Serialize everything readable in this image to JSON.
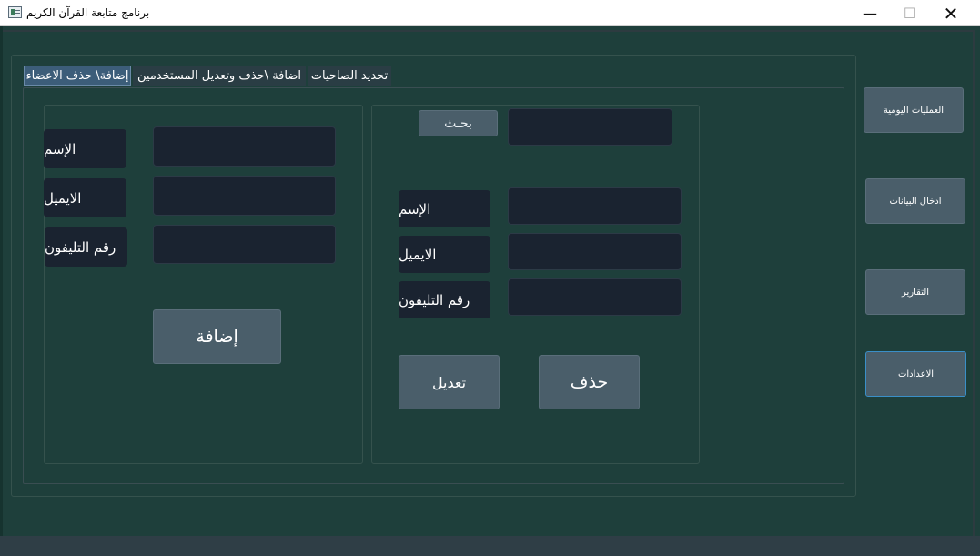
{
  "window": {
    "title": "برنامج متابعة القرآن الكريم",
    "minimize_glyph": "—",
    "maximize_glyph": "☐",
    "close_glyph": "✕"
  },
  "tabs": [
    {
      "label": "إضافة\\ حذف  الاعضاء",
      "active": true
    },
    {
      "label": "اضافة \\حذف وتعديل المستخدمين",
      "active": false
    },
    {
      "label": "تحديد الصاحيات",
      "active": false
    }
  ],
  "add_panel": {
    "labels": {
      "name": "الإسم",
      "email": "الايميل",
      "phone": "رقم التليفون"
    },
    "inputs": {
      "name": "",
      "email": "",
      "phone": ""
    },
    "add_button": "إضافة"
  },
  "edit_panel": {
    "search_button": "بحـث",
    "search_value": "",
    "labels": {
      "name": "الإسم",
      "email": "الايميل",
      "phone": "رقم التليفون"
    },
    "inputs": {
      "name": "",
      "email": "",
      "phone": ""
    },
    "edit_button": "تعديل",
    "delete_button": "حذف"
  },
  "side_nav": [
    {
      "label": "العمليات اليومية",
      "active": false
    },
    {
      "label": "ادخال البيانات",
      "active": false
    },
    {
      "label": "التقارير",
      "active": false
    },
    {
      "label": "الاعدادات",
      "active": true
    }
  ],
  "colors": {
    "background": "#1e3f3b",
    "field": "#1a2330",
    "button": "#4a5e6a",
    "active_tab": "#3c5d79"
  }
}
